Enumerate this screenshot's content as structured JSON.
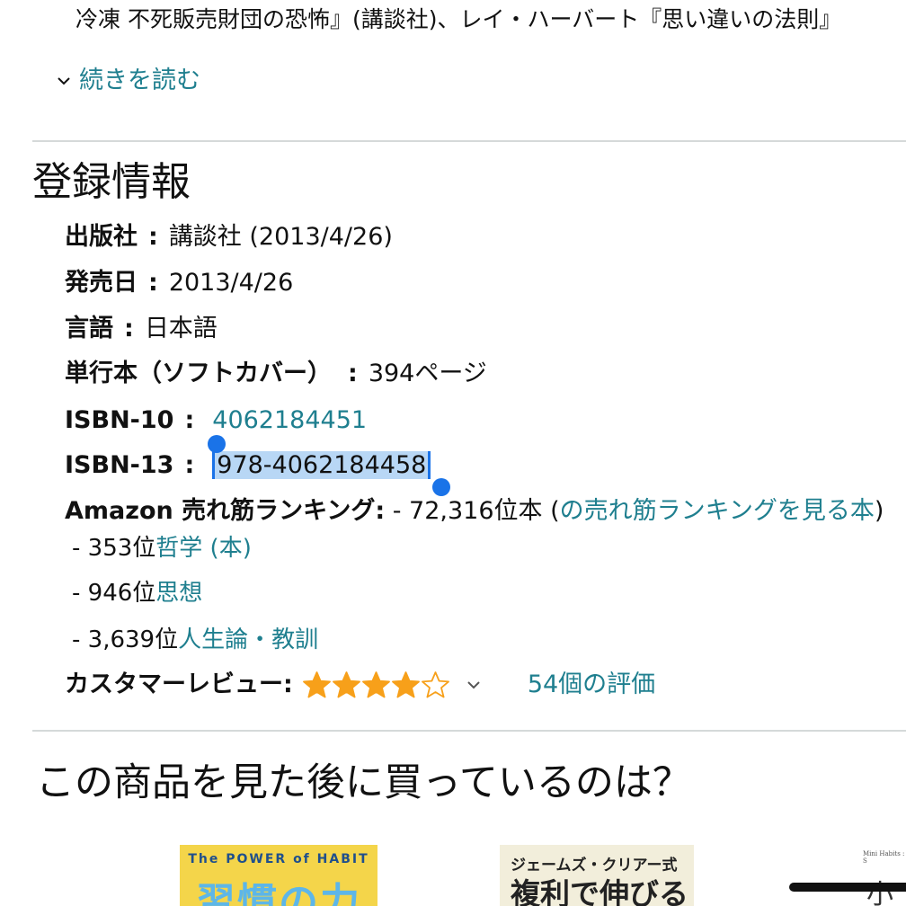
{
  "description": {
    "line": "冷凍 不死販売財団の恐怖』(講談社)、レイ・ハーバート『思い違いの法則』"
  },
  "read_more": {
    "label": "続きを読む"
  },
  "details": {
    "title": "登録情報",
    "separator": ":",
    "publisher": {
      "label": "出版社",
      "value": "講談社 (2013/4/26)"
    },
    "release_date": {
      "label": "発売日",
      "value": "2013/4/26"
    },
    "language": {
      "label": "言語",
      "value": "日本語"
    },
    "format": {
      "label": "単行本（ソフトカバー）",
      "value": "394ページ"
    },
    "isbn10": {
      "label": "ISBN-10",
      "value": "4062184451"
    },
    "isbn13": {
      "label": "ISBN-13",
      "value": "978-4062184458"
    },
    "ranking": {
      "label": "Amazon 売れ筋ランキング:",
      "overall": "- 72,316位本 (",
      "overall_link": "の売れ筋ランキングを見る本",
      "overall_close": ")",
      "categories": [
        {
          "rank": "- 353位",
          "category": "哲学 (本)"
        },
        {
          "rank": "- 946位",
          "category": "思想"
        },
        {
          "rank": "- 3,639位",
          "category": "人生論・教訓"
        }
      ]
    },
    "reviews": {
      "label": "カスタマーレビュー:",
      "rating_stars": 4,
      "rating_max": 5,
      "count_label": "54個の評価"
    }
  },
  "also_bought": {
    "title": "この商品を見た後に買っているのは？",
    "books": [
      {
        "cover_top": "The POWER of HABIT",
        "cover_title": "習慣の力"
      },
      {
        "cover_top": "ジェームズ・クリアー式",
        "cover_title": "複利で伸びる"
      },
      {
        "cover_top": "Mini Habits : S",
        "cover_title": "小さ"
      }
    ]
  },
  "colors": {
    "link": "#1f7f8f",
    "star": "#f7a01a",
    "selection": "#b8d7f5",
    "selection_handle": "#1a73e8",
    "divider": "#d5d9d9"
  }
}
